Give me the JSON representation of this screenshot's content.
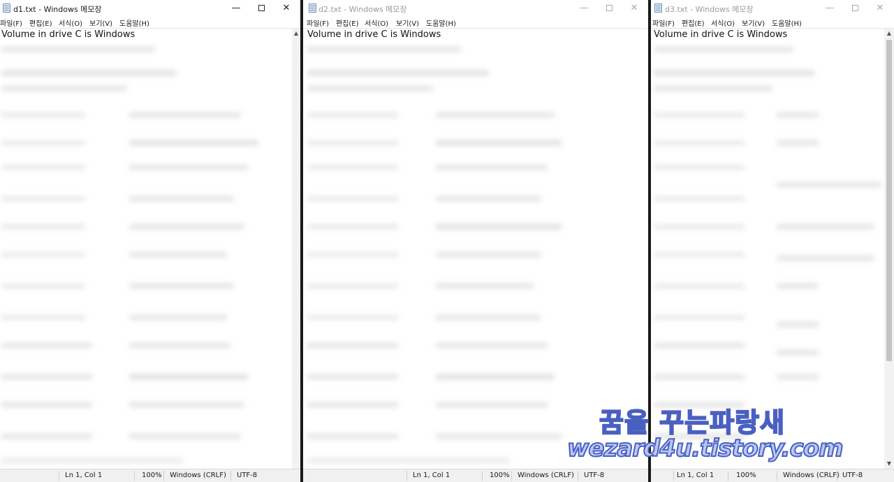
{
  "windows": [
    {
      "title": "d1.txt - Windows 메모장",
      "active": true,
      "controls": {
        "minimize": "—",
        "maximize": "□",
        "close": "✕"
      },
      "menu": [
        "파일(F)",
        "편집(E)",
        "서식(O)",
        "보기(V)",
        "도움말(H)"
      ],
      "first_line": "Volume in drive C is Windows",
      "status": {
        "position": "Ln 1, Col 1",
        "zoom": "100%",
        "line_ending": "Windows (CRLF)",
        "encoding": "UTF-8"
      }
    },
    {
      "title": "d2.txt - Windows 메모장",
      "active": false,
      "controls": {
        "minimize": "—",
        "maximize": "□",
        "close": "✕"
      },
      "menu": [
        "파일(F)",
        "편집(E)",
        "서식(O)",
        "보기(V)",
        "도움말(H)"
      ],
      "first_line": "Volume in drive C is Windows",
      "status": {
        "position": "Ln 1, Col 1",
        "zoom": "100%",
        "line_ending": "Windows (CRLF)",
        "encoding": "UTF-8"
      }
    },
    {
      "title": "d3.txt - Windows 메모장",
      "active": false,
      "controls": {
        "minimize": "—",
        "maximize": "□",
        "close": "✕"
      },
      "menu": [
        "파일(F)",
        "편집(E)",
        "서식(O)",
        "보기(V)",
        "도움말(H)"
      ],
      "first_line": "Volume in drive C is Windows",
      "status": {
        "position": "Ln 1, Col 1",
        "zoom": "100%",
        "line_ending": "Windows (CRLF)",
        "encoding": "UTF-8"
      }
    }
  ],
  "scroll_arrows": {
    "up": "▲",
    "down": "▼"
  },
  "watermark": {
    "line1": "꿈을 꾸는파랑새",
    "line2": "wezard4u.tistory.com"
  },
  "colors": {
    "window_bg": "#ffffff",
    "statusbar_bg": "#f0f0f0",
    "separator": "#1a1a1a",
    "watermark_fill": "#b8c8f4",
    "watermark_stroke": "#4a60c0"
  }
}
